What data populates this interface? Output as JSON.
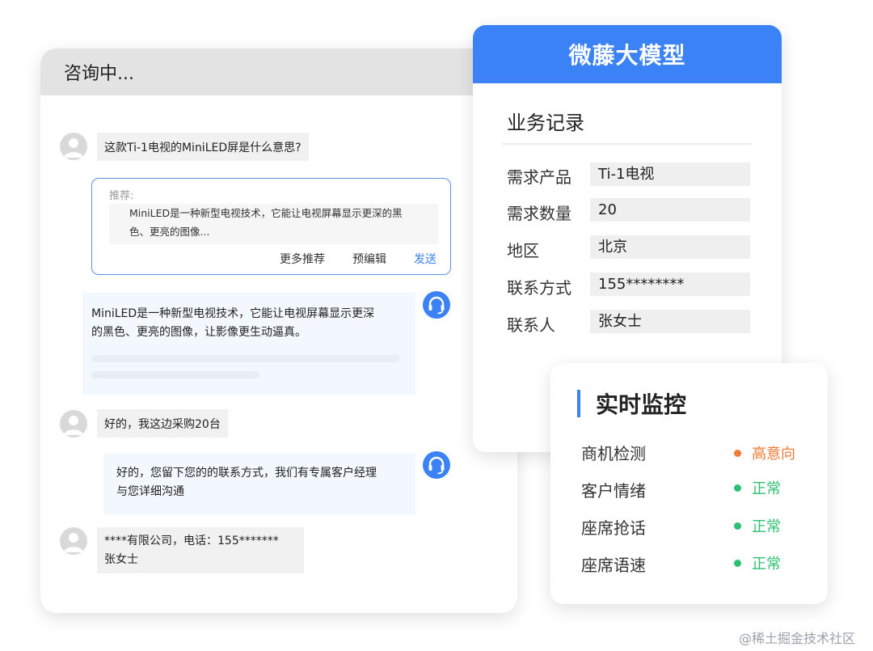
{
  "chat": {
    "header": "咨询中...",
    "messages": {
      "user1": "这款Ti-1电视的MiniLED屏是什么意思?",
      "agent1_line1": "MiniLED是一种新型电视技术，它能让电视屏幕显示更深",
      "agent1_line2": "的黑色、更亮的图像，让影像更生动逼真。",
      "user2": "好的，我这边采购20台",
      "agent2_line1": "好的，您留下您的的联系方式，我们有专属客户经理",
      "agent2_line2": "与您详细沟通",
      "user3_line1": "****有限公司，电话：155*******",
      "user3_line2": "张女士"
    },
    "recommend": {
      "label": "推荐:",
      "text_line1": "MiniLED是一种新型电视技术，它能让电视屏幕显示更深的黑",
      "text_line2": "色、更亮的图像...",
      "more": "更多推荐",
      "edit": "预编辑",
      "send": "发送"
    }
  },
  "model": {
    "title": "微藤大模型",
    "section": "业务记录",
    "fields": [
      {
        "label": "需求产品",
        "value": "Ti-1电视"
      },
      {
        "label": "需求数量",
        "value": "20"
      },
      {
        "label": "地区",
        "value": "北京"
      },
      {
        "label": "联系方式",
        "value": "155********"
      },
      {
        "label": "联系人",
        "value": "张女士"
      }
    ]
  },
  "monitor": {
    "title": "实时监控",
    "items": [
      {
        "label": "商机检测",
        "status": "高意向",
        "color": "#f07c3a"
      },
      {
        "label": "客户情绪",
        "status": "正常",
        "color": "#2fbf71"
      },
      {
        "label": "座席抢话",
        "status": "正常",
        "color": "#2fbf71"
      },
      {
        "label": "座席语速",
        "status": "正常",
        "color": "#2fbf71"
      }
    ]
  },
  "colors": {
    "accent": "#3b82f6",
    "high_intent": "#f07c3a",
    "normal": "#2fbf71"
  },
  "icons": {
    "user_avatar": "user-icon",
    "agent_avatar": "headset-icon"
  },
  "watermark": "@稀土掘金技术社区"
}
